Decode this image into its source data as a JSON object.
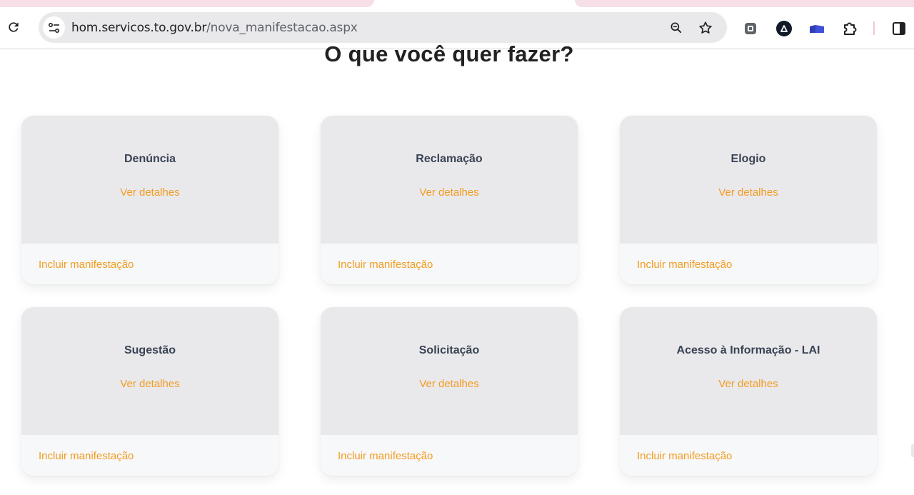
{
  "browser": {
    "url_domain": "hom.servicos.to.gov.br",
    "url_path": "/nova_manifestacao.aspx",
    "icons": [
      "reload-icon",
      "site-info-icon",
      "zoom-icon",
      "bookmark-star-icon",
      "extension-icon-1",
      "extension-icon-2",
      "extension-icon-3",
      "extensions-puzzle-icon",
      "side-panel-icon"
    ],
    "colors": {
      "tab_pink": "#f6dfe7",
      "omnibox": "#e9e9ec"
    }
  },
  "page": {
    "title": "O que você quer fazer?",
    "colors": {
      "accent": "#f39b1f",
      "card_top": "#e9e9ec",
      "card_bottom": "#f7f8fa",
      "card_title": "#3a4354"
    },
    "cards": [
      {
        "title": "Denúncia",
        "details": "Ver detalhes",
        "action": "Incluir manifestação"
      },
      {
        "title": "Reclamação",
        "details": "Ver detalhes",
        "action": "Incluir manifestação"
      },
      {
        "title": "Elogio",
        "details": "Ver detalhes",
        "action": "Incluir manifestação"
      },
      {
        "title": "Sugestão",
        "details": "Ver detalhes",
        "action": "Incluir manifestação"
      },
      {
        "title": "Solicitação",
        "details": "Ver detalhes",
        "action": "Incluir manifestação"
      },
      {
        "title": "Acesso à Informação - LAI",
        "details": "Ver detalhes",
        "action": "Incluir manifestação"
      }
    ]
  }
}
